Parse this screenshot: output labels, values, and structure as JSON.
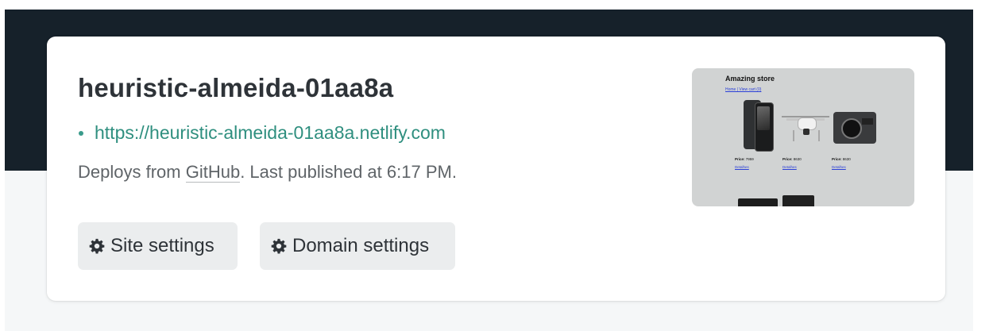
{
  "site": {
    "name": "heuristic-almeida-01aa8a",
    "url": "https://heuristic-almeida-01aa8a.netlify.com",
    "deploy_prefix": "Deploys from ",
    "deploy_source": "GitHub",
    "deploy_suffix": ". Last published at 6:17 PM."
  },
  "buttons": {
    "site_settings": "Site settings",
    "domain_settings": "Domain settings"
  },
  "preview": {
    "title": "Amazing store",
    "links": "Home | View cart (0)",
    "products": [
      {
        "price_label": "Price:",
        "price": "7959",
        "link": "Detalhes"
      },
      {
        "price_label": "Price:",
        "price": "8630",
        "link": "Detalhes"
      },
      {
        "price_label": "Price:",
        "price": "8630",
        "link": "Detalhes"
      }
    ]
  },
  "colors": {
    "header_bg": "#16212a",
    "page_bg": "#f5f7f8",
    "link": "#2f8f7f",
    "title": "#2e3338",
    "button_bg": "#ebedee"
  },
  "icons": {
    "settings": "gear-icon"
  }
}
